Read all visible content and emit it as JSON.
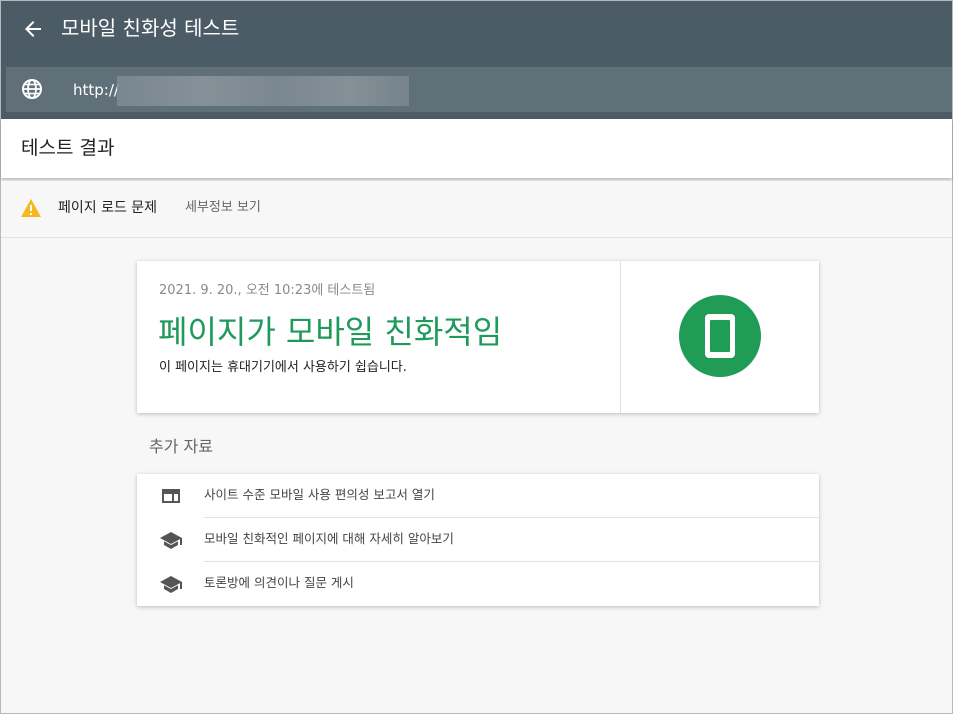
{
  "appbar": {
    "title": "모바일 친화성 테스트"
  },
  "urlbar": {
    "url": "http://"
  },
  "header": {
    "title": "테스트 결과"
  },
  "warning": {
    "text": "페이지 로드 문제",
    "link": "세부정보 보기"
  },
  "result": {
    "timestamp": "2021. 9. 20., 오전 10:23에 테스트됨",
    "verdict": "페이지가 모바일 친화적임",
    "description": "이 페이지는 휴대기기에서 사용하기 쉽습니다."
  },
  "resources": {
    "title": "추가 자료",
    "items": [
      {
        "label": "사이트 수준 모바일 사용 편의성 보고서 열기",
        "icon": "report-icon"
      },
      {
        "label": "모바일 친화적인 페이지에 대해 자세히 알아보기",
        "icon": "school-icon"
      },
      {
        "label": "토론방에 의견이나 질문 게시",
        "icon": "school-icon"
      }
    ]
  },
  "colors": {
    "appbar": "#4b5c66",
    "urlbar": "#5f7079",
    "success": "#1e9a5a",
    "warning": "#f6b820"
  }
}
